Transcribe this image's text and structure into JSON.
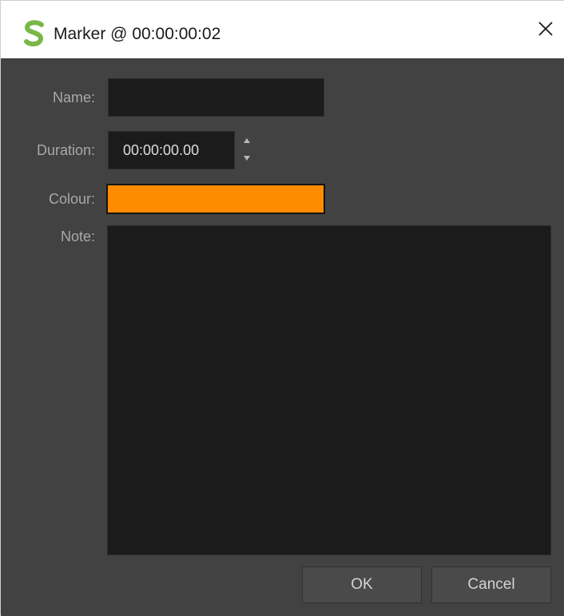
{
  "window": {
    "title": "Marker @ 00:00:00:02",
    "app_icon": "shotcut-s-logo-icon",
    "close_icon": "close-icon"
  },
  "form": {
    "name_label": "Name:",
    "name_value": "",
    "duration_label": "Duration:",
    "duration_value": "00:00:00.00",
    "spin_up_icon": "triangle-up-icon",
    "spin_down_icon": "triangle-down-icon",
    "colour_label": "Colour:",
    "colour_value": "#ff8c00",
    "note_label": "Note:",
    "note_value": ""
  },
  "buttons": {
    "ok_label": "OK",
    "cancel_label": "Cancel"
  },
  "colors": {
    "dialog_background": "#424242",
    "field_background": "#1b1b1b",
    "accent_logo": "#7ab648"
  }
}
